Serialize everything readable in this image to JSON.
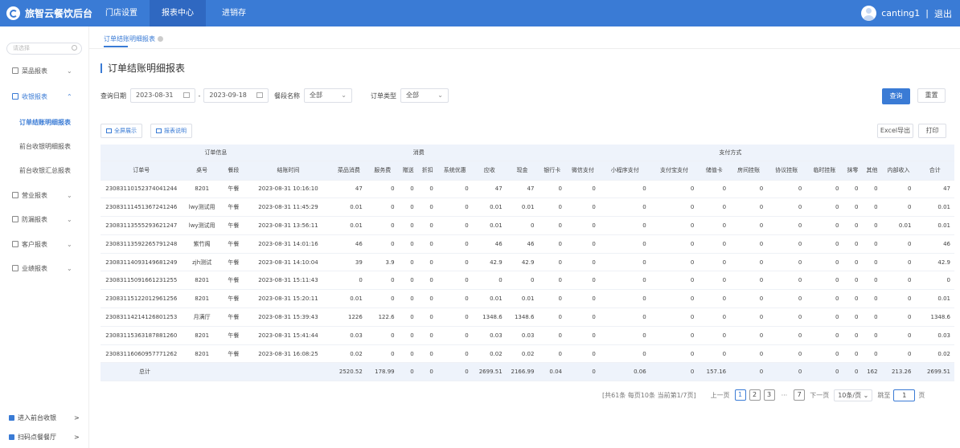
{
  "topbar": {
    "brand": "旅智云餐饮后台",
    "nav": [
      "门店设置",
      "报表中心",
      "进销存"
    ],
    "user": "canting1",
    "separator": "|",
    "logout": "退出"
  },
  "sidebar": {
    "search_placeholder": "请选择",
    "groups": [
      {
        "label": "菜品报表",
        "chev": "⌄"
      },
      {
        "label": "收银报表",
        "chev": "⌃"
      },
      {
        "label": "营业报表",
        "chev": "⌄"
      },
      {
        "label": "防漏报表",
        "chev": "⌄"
      },
      {
        "label": "客户报表",
        "chev": "⌄"
      },
      {
        "label": "业绩报表",
        "chev": "⌄"
      }
    ],
    "sub_items": [
      "订单结账明细报表",
      "前台收银明细报表",
      "前台收银汇总报表"
    ],
    "links": [
      "进入前台收银",
      "扫码点餐餐厅"
    ],
    "link_arrow": ">"
  },
  "tab": {
    "label": "订单结账明细报表"
  },
  "page_title": "订单结账明细报表",
  "filters": {
    "date_label": "查询日期",
    "date_start": "2023-08-31",
    "date_sep": "-",
    "date_end": "2023-09-18",
    "section_label": "餐段名称",
    "section_value": "全部",
    "order_type_label": "订单类型",
    "order_type_value": "全部",
    "dropdown_glyph": "⌄"
  },
  "buttons": {
    "query": "查询",
    "reset": "重置",
    "fullscreen": "全屏展示",
    "report_desc": "报表说明",
    "excel": "Excel导出",
    "print": "打印"
  },
  "table": {
    "groups": [
      {
        "label": "订单信息"
      },
      {
        "label": "消费"
      },
      {
        "label": "支付方式"
      }
    ],
    "columns": [
      "订单号",
      "桌号",
      "餐段",
      "结账时间",
      "菜品消费",
      "服务费",
      "赠送",
      "折扣",
      "系统优惠",
      "应收",
      "现金",
      "银行卡",
      "微信支付",
      "小程序支付",
      "支付宝支付",
      "储值卡",
      "房间挂账",
      "协议挂账",
      "临时挂账",
      "抹零",
      "其他",
      "内部收入",
      "合计"
    ],
    "rows": [
      [
        "23083110152374041244",
        "8201",
        "午餐",
        "2023-08-31 10:16:10",
        "47",
        "0",
        "0",
        "0",
        "0",
        "47",
        "47",
        "0",
        "0",
        "0",
        "0",
        "0",
        "0",
        "0",
        "0",
        "0",
        "0",
        "0",
        "47"
      ],
      [
        "23083111451367241246",
        "lwy测试用",
        "午餐",
        "2023-08-31 11:45:29",
        "0.01",
        "0",
        "0",
        "0",
        "0",
        "0.01",
        "0.01",
        "0",
        "0",
        "0",
        "0",
        "0",
        "0",
        "0",
        "0",
        "0",
        "0",
        "0",
        "0.01"
      ],
      [
        "23083113555293621247",
        "lwy测试用",
        "午餐",
        "2023-08-31 13:56:11",
        "0.01",
        "0",
        "0",
        "0",
        "0",
        "0.01",
        "0",
        "0",
        "0",
        "0",
        "0",
        "0",
        "0",
        "0",
        "0",
        "0",
        "0",
        "0.01",
        "0.01"
      ],
      [
        "23083113592265791248",
        "紫竹阁",
        "午餐",
        "2023-08-31 14:01:16",
        "46",
        "0",
        "0",
        "0",
        "0",
        "46",
        "46",
        "0",
        "0",
        "0",
        "0",
        "0",
        "0",
        "0",
        "0",
        "0",
        "0",
        "0",
        "46"
      ],
      [
        "23083114093149681249",
        "zjh测试",
        "午餐",
        "2023-08-31 14:10:04",
        "39",
        "3.9",
        "0",
        "0",
        "0",
        "42.9",
        "42.9",
        "0",
        "0",
        "0",
        "0",
        "0",
        "0",
        "0",
        "0",
        "0",
        "0",
        "0",
        "42.9"
      ],
      [
        "23083115091661231255",
        "8201",
        "午餐",
        "2023-08-31 15:11:43",
        "0",
        "0",
        "0",
        "0",
        "0",
        "0",
        "0",
        "0",
        "0",
        "0",
        "0",
        "0",
        "0",
        "0",
        "0",
        "0",
        "0",
        "0",
        "0"
      ],
      [
        "23083115122012961256",
        "8201",
        "午餐",
        "2023-08-31 15:20:11",
        "0.01",
        "0",
        "0",
        "0",
        "0",
        "0.01",
        "0.01",
        "0",
        "0",
        "0",
        "0",
        "0",
        "0",
        "0",
        "0",
        "0",
        "0",
        "0",
        "0.01"
      ],
      [
        "23083114214126801253",
        "月满厅",
        "午餐",
        "2023-08-31 15:39:43",
        "1226",
        "122.6",
        "0",
        "0",
        "0",
        "1348.6",
        "1348.6",
        "0",
        "0",
        "0",
        "0",
        "0",
        "0",
        "0",
        "0",
        "0",
        "0",
        "0",
        "1348.6"
      ],
      [
        "23083115363187881260",
        "8201",
        "午餐",
        "2023-08-31 15:41:44",
        "0.03",
        "0",
        "0",
        "0",
        "0",
        "0.03",
        "0.03",
        "0",
        "0",
        "0",
        "0",
        "0",
        "0",
        "0",
        "0",
        "0",
        "0",
        "0",
        "0.03"
      ],
      [
        "23083116060957771262",
        "8201",
        "午餐",
        "2023-08-31 16:08:25",
        "0.02",
        "0",
        "0",
        "0",
        "0",
        "0.02",
        "0.02",
        "0",
        "0",
        "0",
        "0",
        "0",
        "0",
        "0",
        "0",
        "0",
        "0",
        "0",
        "0.02"
      ]
    ],
    "total_label": "总计",
    "total": [
      "2520.52",
      "178.99",
      "0",
      "0",
      "0",
      "2699.51",
      "2166.99",
      "0.04",
      "0",
      "0.06",
      "0",
      "157.16",
      "0",
      "0",
      "0",
      "0",
      "162",
      "213.26",
      "2699.51"
    ]
  },
  "pagination": {
    "summary": "[共61条 每页10条 当前第1/7页]",
    "prev": "上一页",
    "pages": [
      "1",
      "2",
      "3"
    ],
    "ellipsis": "···",
    "last": "7",
    "next": "下一页",
    "page_size": "10条/页",
    "goto_label": "跳至",
    "goto_value": "1",
    "goto_suffix": "页"
  },
  "colors": {
    "accent": "#3a7bd5",
    "header_bg": "#eef3fb"
  }
}
